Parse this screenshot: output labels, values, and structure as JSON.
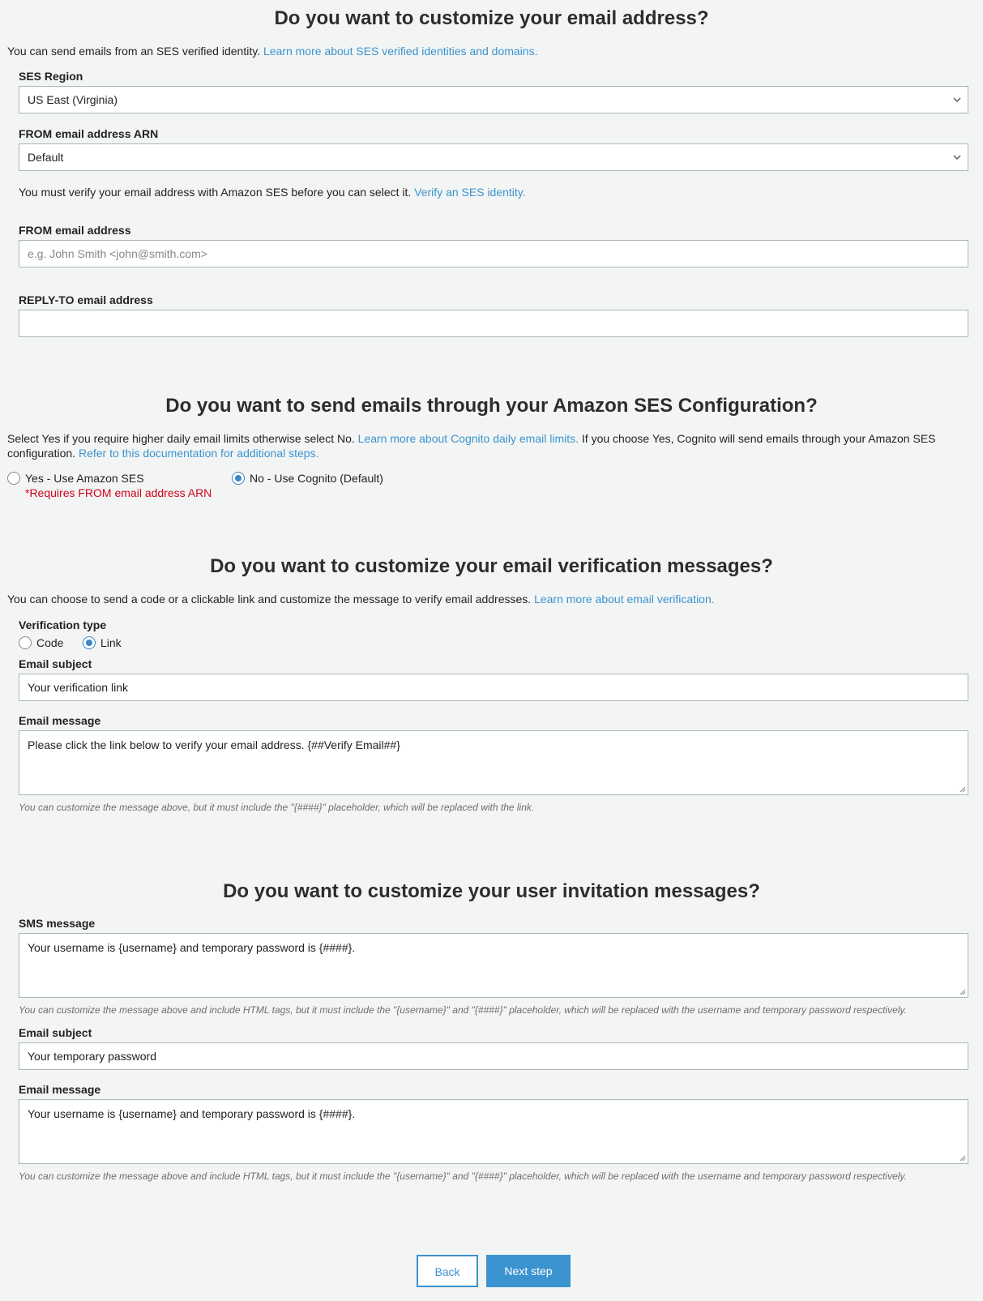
{
  "section1": {
    "title": "Do you want to customize your email address?",
    "desc": "You can send emails from an SES verified identity.",
    "desc_link": "Learn more about SES verified identities and domains.",
    "region_label": "SES Region",
    "region_value": "US East (Virginia)",
    "arn_label": "FROM email address ARN",
    "arn_value": "Default",
    "verify_note": "You must verify your email address with Amazon SES before you can select it.",
    "verify_link": "Verify an SES identity.",
    "from_label": "FROM email address",
    "from_placeholder": "e.g. John Smith <john@smith.com>",
    "reply_label": "REPLY-TO email address",
    "reply_value": ""
  },
  "section2": {
    "title": "Do you want to send emails through your Amazon SES Configuration?",
    "desc_a": "Select Yes if you require higher daily email limits otherwise select No.",
    "desc_link1": "Learn more about Cognito daily email limits.",
    "desc_b": "If you choose Yes, Cognito will send emails through your Amazon SES configuration.",
    "desc_link2": "Refer to this documentation for additional steps.",
    "opt_yes": "Yes - Use Amazon SES",
    "opt_yes_note": "*Requires FROM email address ARN",
    "opt_no": "No - Use Cognito (Default)",
    "selected": "no"
  },
  "section3": {
    "title": "Do you want to customize your email verification messages?",
    "desc": "You can choose to send a code or a clickable link and customize the message to verify email addresses.",
    "desc_link": "Learn more about email verification.",
    "type_label": "Verification type",
    "type_code": "Code",
    "type_link": "Link",
    "selected": "link",
    "subject_label": "Email subject",
    "subject_value": "Your verification link",
    "message_label": "Email message",
    "message_value": "Please click the link below to verify your email address. {##Verify Email##}",
    "hint": "You can customize the message above, but it must include the \"{####}\" placeholder, which will be replaced with the link."
  },
  "section4": {
    "title": "Do you want to customize your user invitation messages?",
    "sms_label": "SMS message",
    "sms_value": "Your username is {username} and temporary password is {####}.",
    "sms_hint": "You can customize the message above and include HTML tags, but it must include the \"{username}\" and \"{####}\" placeholder, which will be replaced with the username and temporary password respectively.",
    "subject_label": "Email subject",
    "subject_value": "Your temporary password",
    "message_label": "Email message",
    "message_value": "Your username is {username} and temporary password is {####}.",
    "message_hint": "You can customize the message above and include HTML tags, but it must include the \"{username}\" and \"{####}\" placeholder, which will be replaced with the username and temporary password respectively."
  },
  "footer": {
    "back_label": "Back",
    "next_label": "Next step"
  },
  "colors": {
    "link": "#3b93d0",
    "warning": "#d0021b",
    "primary": "#3b93d0",
    "background": "#f3f5f4"
  },
  "icons": {
    "select": "chevron-down-icon",
    "textarea": "resize-grip-icon"
  }
}
